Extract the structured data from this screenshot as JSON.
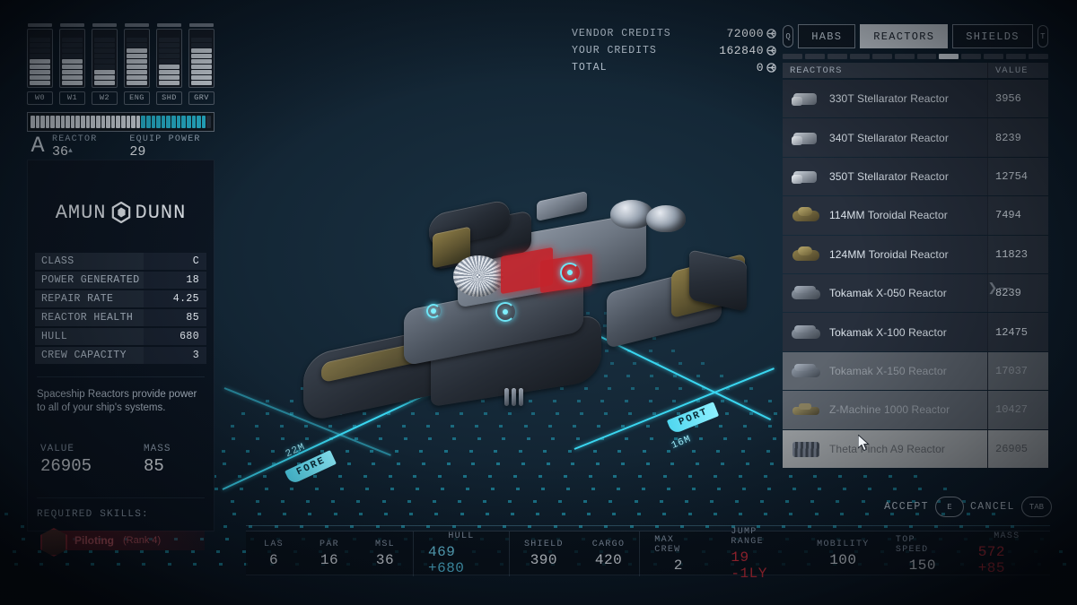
{
  "module_title": "Theta Pinch A9 Reactor",
  "brand": {
    "left": "AMUN",
    "right": "DUNN"
  },
  "power_columns": [
    {
      "label": "W0",
      "filled": 5,
      "total": 9
    },
    {
      "label": "W1",
      "filled": 5,
      "total": 9
    },
    {
      "label": "W2",
      "filled": 3,
      "total": 9
    },
    {
      "label": "ENG",
      "filled": 7,
      "total": 9
    },
    {
      "label": "SHD",
      "filled": 4,
      "total": 9
    },
    {
      "label": "GRV",
      "filled": 7,
      "total": 9
    }
  ],
  "reactor_meter": {
    "white_segments": 22,
    "cyan_segments": 13,
    "empty_segments": 1,
    "total_segments": 36
  },
  "reactor_readout": {
    "class_glyph": "A",
    "reactor_label": "REACTOR",
    "reactor_value": "36",
    "equip_label": "EQUIP POWER",
    "equip_value": "29"
  },
  "stats": [
    {
      "key": "CLASS",
      "value": "C"
    },
    {
      "key": "POWER GENERATED",
      "value": "18"
    },
    {
      "key": "REPAIR RATE",
      "value": "4.25"
    },
    {
      "key": "REACTOR HEALTH",
      "value": "85"
    },
    {
      "key": "HULL",
      "value": "680"
    },
    {
      "key": "CREW CAPACITY",
      "value": "3"
    }
  ],
  "description": "Spaceship Reactors provide power to all of your ship's systems.",
  "value_block": {
    "value_label": "VALUE",
    "value": "26905",
    "mass_label": "MASS",
    "mass": "85"
  },
  "skills": {
    "heading": "REQUIRED SKILLS:",
    "items": [
      {
        "name": "Piloting",
        "rank": "(Rank 4)"
      }
    ]
  },
  "credits": [
    {
      "label": "VENDOR CREDITS",
      "value": "72000"
    },
    {
      "label": "YOUR CREDITS",
      "value": "162840"
    },
    {
      "label": "TOTAL",
      "value": "0"
    }
  ],
  "tabs": {
    "prev_key": "Q",
    "next_key": "T",
    "items": [
      {
        "label": "HABS",
        "active": false
      },
      {
        "label": "REACTORS",
        "active": true
      },
      {
        "label": "SHIELDS",
        "active": false
      }
    ],
    "segment_count": 12,
    "active_segment_index": 7
  },
  "list_header": {
    "name_col": "REACTORS",
    "value_col": "VALUE"
  },
  "reactor_list": [
    {
      "name": "330T Stellarator Reactor",
      "value": "3956",
      "state": "normal",
      "icon": "stellarator-reactor-icon"
    },
    {
      "name": "340T Stellarator Reactor",
      "value": "8239",
      "state": "normal",
      "icon": "stellarator-reactor-icon"
    },
    {
      "name": "350T Stellarator Reactor",
      "value": "12754",
      "state": "normal",
      "icon": "stellarator-reactor-icon"
    },
    {
      "name": "114MM Toroidal Reactor",
      "value": "7494",
      "state": "normal",
      "icon": "toroidal-reactor-icon"
    },
    {
      "name": "124MM Toroidal Reactor",
      "value": "11823",
      "state": "normal",
      "icon": "toroidal-reactor-icon"
    },
    {
      "name": "Tokamak X-050 Reactor",
      "value": "8239",
      "state": "normal",
      "icon": "tokamak-reactor-icon"
    },
    {
      "name": "Tokamak X-100 Reactor",
      "value": "12475",
      "state": "normal",
      "icon": "tokamak-reactor-icon"
    },
    {
      "name": "Tokamak X-150 Reactor",
      "value": "17037",
      "state": "disabled",
      "icon": "tokamak-reactor-icon"
    },
    {
      "name": "Z-Machine 1000 Reactor",
      "value": "10427",
      "state": "disabled",
      "icon": "zmachine-reactor-icon"
    },
    {
      "name": "Theta Pinch A9 Reactor",
      "value": "26905",
      "state": "selected",
      "icon": "theta-pinch-reactor-icon"
    }
  ],
  "actions": [
    {
      "label": "ACCEPT",
      "key": "E"
    },
    {
      "label": "CANCEL",
      "key": "TAB"
    }
  ],
  "ship_stats": [
    {
      "label": "LAS",
      "value": "6",
      "color": "white",
      "group": 0
    },
    {
      "label": "PAR",
      "value": "16",
      "color": "white",
      "group": 0
    },
    {
      "label": "MSL",
      "value": "36",
      "color": "white",
      "group": 0
    },
    {
      "label": "HULL",
      "value": "469",
      "delta": "+680",
      "color": "cyan",
      "group": 1
    },
    {
      "label": "SHIELD",
      "value": "390",
      "color": "white",
      "group": 2
    },
    {
      "label": "CARGO",
      "value": "420",
      "color": "white",
      "group": 2
    },
    {
      "label": "MAX CREW",
      "value": "2",
      "color": "white",
      "group": 3
    },
    {
      "label": "JUMP RANGE",
      "value": "19",
      "delta": "-1LY",
      "color": "red",
      "group": 3
    },
    {
      "label": "MOBILITY",
      "value": "100",
      "color": "white",
      "group": 3
    },
    {
      "label": "TOP SPEED",
      "value": "150",
      "color": "white",
      "group": 3
    },
    {
      "label": "MASS",
      "value": "572",
      "delta": "+85",
      "color": "red",
      "group": 3
    }
  ],
  "viewport_labels": {
    "fore": "FORE",
    "port": "PORT",
    "length_label": "22M",
    "width_label": "16M"
  },
  "colors": {
    "accent_cyan": "#62dcef",
    "grid_cyan": "#3ad6f0",
    "warn_red": "#e0313f",
    "panel_dark": "#0d1622",
    "list_row": "#272f3c",
    "list_selected": "#9fa3a6"
  }
}
